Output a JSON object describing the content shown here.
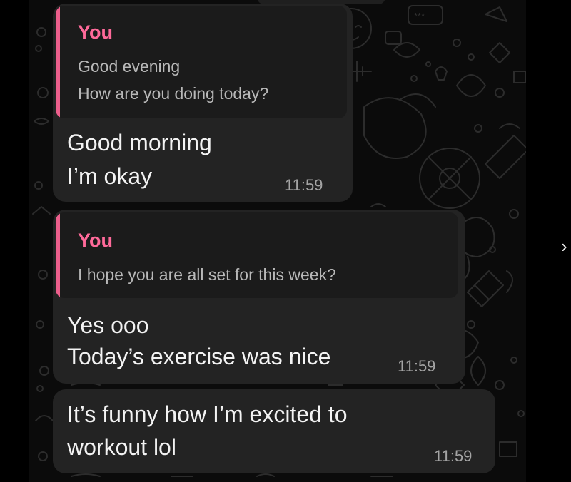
{
  "messages": [
    {
      "quote": {
        "author": "You",
        "lines": [
          "Good evening",
          "How are you doing today?"
        ]
      },
      "lines": [
        "Good morning",
        "I’m okay"
      ],
      "time": "11:59"
    },
    {
      "quote": {
        "author": "You",
        "lines": [
          "I hope you are all set for this week?"
        ]
      },
      "lines": [
        "Yes ooo",
        "Today’s exercise was nice"
      ],
      "time": "11:59"
    },
    {
      "lines": [
        "It’s funny how I’m excited to",
        "workout lol"
      ],
      "time": "11:59"
    }
  ],
  "wallpaper": {
    "sticker_text": "***"
  },
  "edge_glyph": "›",
  "colors": {
    "background": "#000000",
    "chat_background": "#0b0b0b",
    "bubble": "#232323",
    "quote_block": "#1b1b1b",
    "quote_accent": "#ec5f8c",
    "quote_author": "#ff6a9a",
    "message_text": "#f3f3f3",
    "timestamp": "#a4a4a4"
  }
}
